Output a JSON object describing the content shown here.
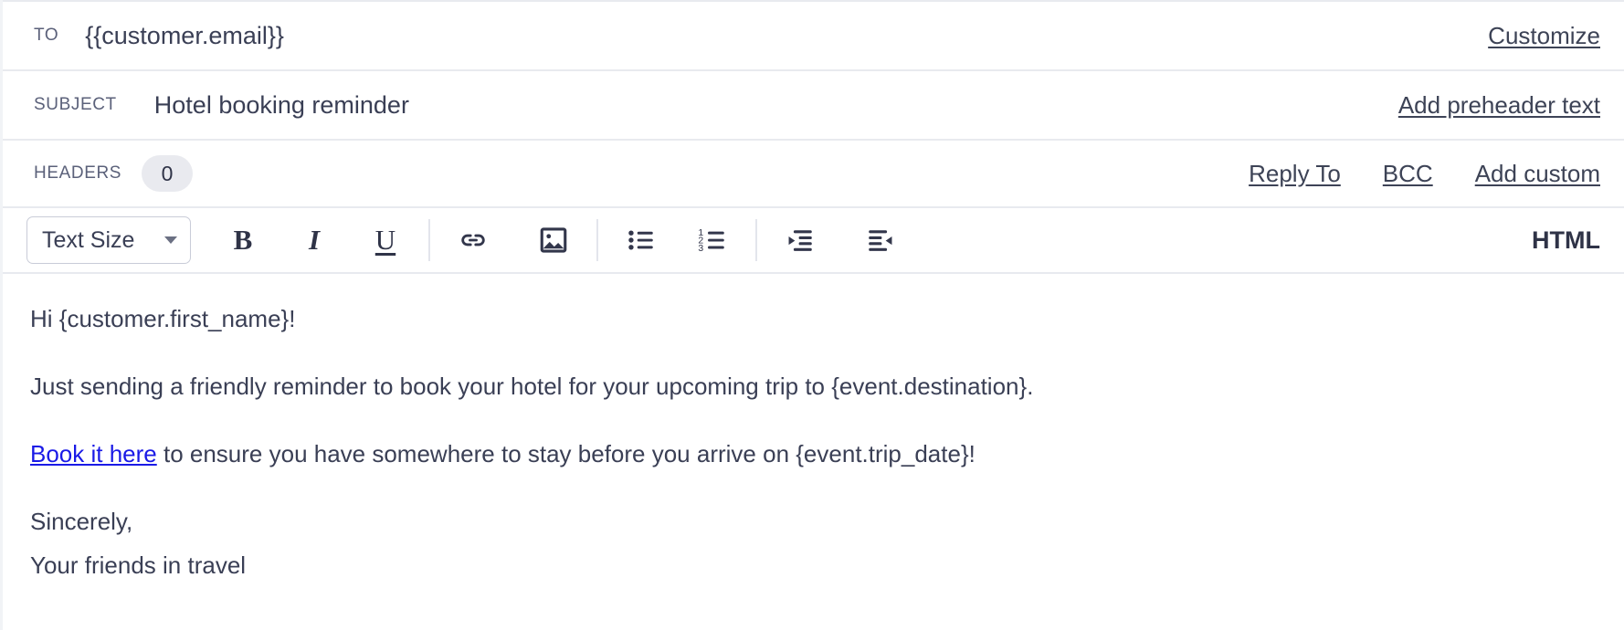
{
  "fields": {
    "to": {
      "label": "TO",
      "value": "{{customer.email}}",
      "action": "Customize"
    },
    "subject": {
      "label": "SUBJECT",
      "value": "Hotel booking reminder",
      "action": "Add preheader text"
    },
    "headers": {
      "label": "HEADERS",
      "count": "0",
      "actions": [
        "Reply To",
        "BCC",
        "Add custom"
      ]
    }
  },
  "toolbar": {
    "text_size_label": "Text Size",
    "bold": "B",
    "italic": "I",
    "underline": "U",
    "html_label": "HTML",
    "icons": {
      "link": "link-icon",
      "image": "image-icon",
      "bulleted_list": "bulleted-list-icon",
      "numbered_list": "numbered-list-icon",
      "outdent": "outdent-icon",
      "indent": "indent-icon"
    }
  },
  "body": {
    "greeting": "Hi {customer.first_name}!",
    "paragraph": "Just sending a friendly reminder to book your hotel for your upcoming trip to {event.destination}.",
    "cta_link_text": "Book it here",
    "cta_rest": " to ensure you have somewhere to stay before you arrive on {event.trip_date}!",
    "signoff": "Sincerely,",
    "signature": "Your friends in travel"
  },
  "colors": {
    "text": "#3a3f55",
    "label": "#5b617a",
    "link": "#1a1ae6",
    "border": "#e8eaef",
    "badge_bg": "#e9eaef"
  }
}
